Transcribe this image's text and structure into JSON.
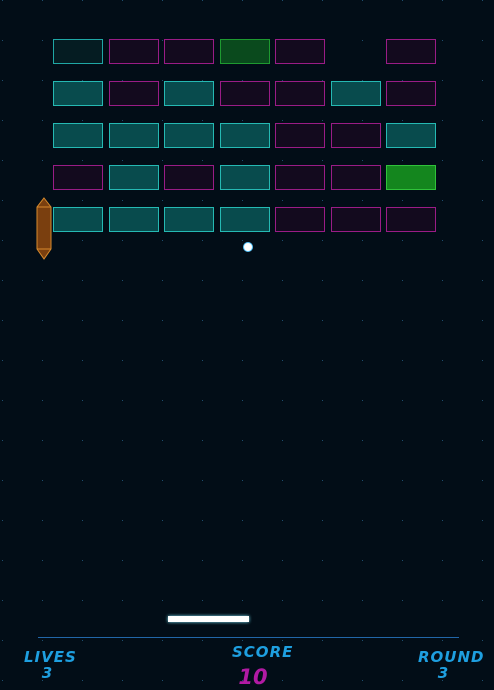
{
  "game": {
    "bricks": [
      [
        "teal-dark",
        "magenta",
        "magenta",
        "green-dark",
        "magenta",
        "empty",
        "magenta"
      ],
      [
        "teal",
        "magenta",
        "teal",
        "magenta",
        "magenta",
        "teal",
        "magenta"
      ],
      [
        "teal",
        "teal",
        "teal",
        "teal",
        "magenta",
        "magenta",
        "teal"
      ],
      [
        "magenta",
        "teal",
        "magenta",
        "teal",
        "magenta",
        "magenta",
        "green"
      ],
      [
        "teal",
        "teal",
        "teal",
        "teal",
        "magenta",
        "magenta",
        "magenta"
      ]
    ],
    "powerup": {
      "type": "paddle-extend",
      "color": "#8a4b14"
    }
  },
  "hud": {
    "lives_label": "LIVES",
    "lives_value": "3",
    "score_label": "SCORE",
    "score_value": "10",
    "round_label": "ROUND",
    "round_value": "3"
  },
  "colors": {
    "background": "#020d17",
    "hud_text": "#1e9fe0",
    "score_value": "#b11aa3",
    "hud_line": "#2166a8"
  }
}
